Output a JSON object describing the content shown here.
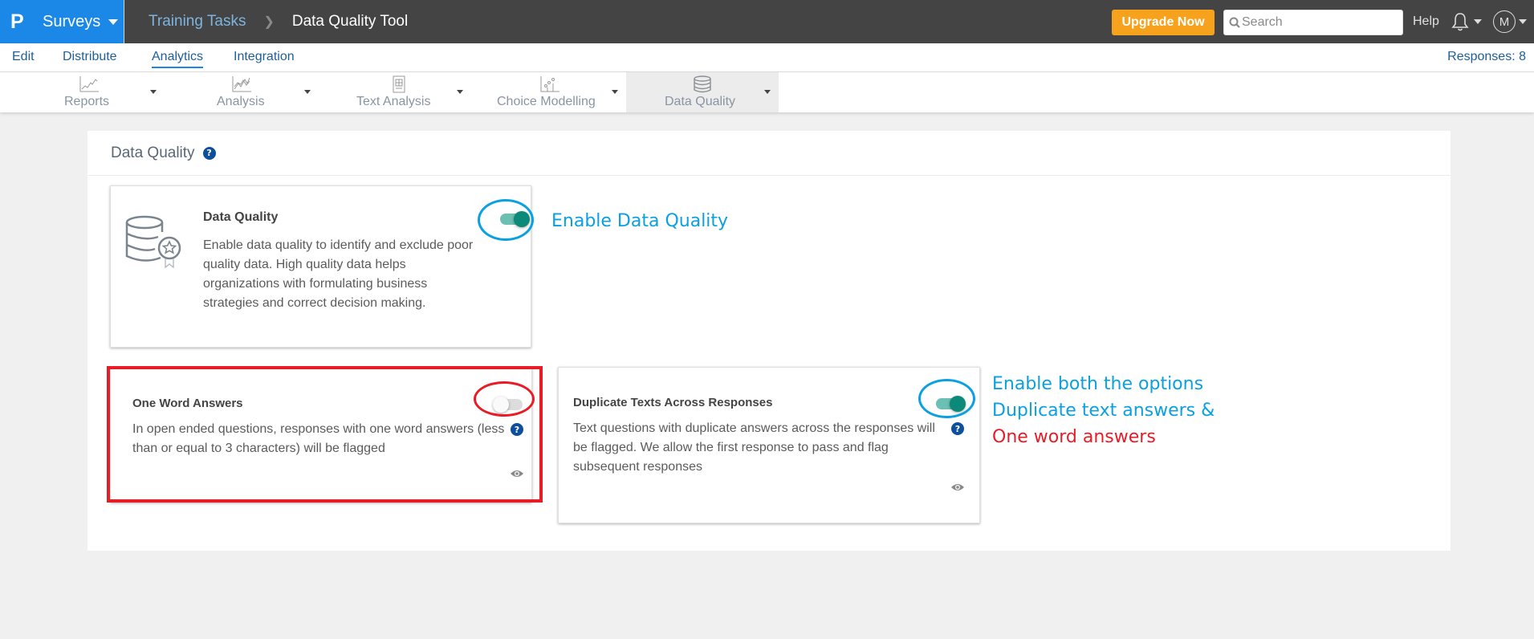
{
  "header": {
    "logo": "P",
    "app_name": "Surveys",
    "breadcrumb": [
      "Training Tasks",
      "Data Quality Tool"
    ],
    "upgrade_label": "Upgrade Now",
    "search_placeholder": "Search",
    "help_label": "Help",
    "avatar_initial": "M"
  },
  "nav": {
    "items": [
      {
        "label": "Edit"
      },
      {
        "label": "Distribute"
      },
      {
        "label": "Analytics",
        "active": true
      },
      {
        "label": "Integration"
      }
    ],
    "responses": "Responses: 8"
  },
  "toolbar": {
    "tools": [
      {
        "label": "Reports",
        "icon": "line-chart-icon"
      },
      {
        "label": "Analysis",
        "icon": "multi-line-chart-icon"
      },
      {
        "label": "Text Analysis",
        "icon": "text-document-icon"
      },
      {
        "label": "Choice Modelling",
        "icon": "scatter-chart-icon"
      },
      {
        "label": "Data Quality",
        "icon": "database-icon",
        "active": true
      }
    ]
  },
  "panel": {
    "title": "Data Quality",
    "cards": {
      "main": {
        "title": "Data Quality",
        "description": "Enable data quality to identify and exclude poor quality data. High quality data helps organizations with formulating business strategies and correct decision making.",
        "enabled": true
      },
      "one_word": {
        "title": "One Word Answers",
        "description": "In open ended questions, responses with one word answers (less than or equal to 3 characters) will be flagged",
        "enabled": false
      },
      "duplicate": {
        "title": "Duplicate Texts Across Responses",
        "description": "Text questions with duplicate answers across the responses will be flagged. We allow the first response to pass and flag subsequent responses",
        "enabled": true
      }
    }
  },
  "annotations": {
    "enable_dq": "Enable Data Quality",
    "enable_both_line1": "Enable both the options",
    "enable_both_line2": "Duplicate text answers &",
    "enable_both_line3": "One word answers",
    "colors": {
      "blue": "#0aa0e2",
      "red": "#e81c25"
    }
  },
  "colors": {
    "brand_blue": "#1b87e6",
    "header_bg": "#444444",
    "upgrade_orange": "#f7a21c",
    "toggle_on": "#0b8a79",
    "help_icon": "#0d4f9c"
  }
}
